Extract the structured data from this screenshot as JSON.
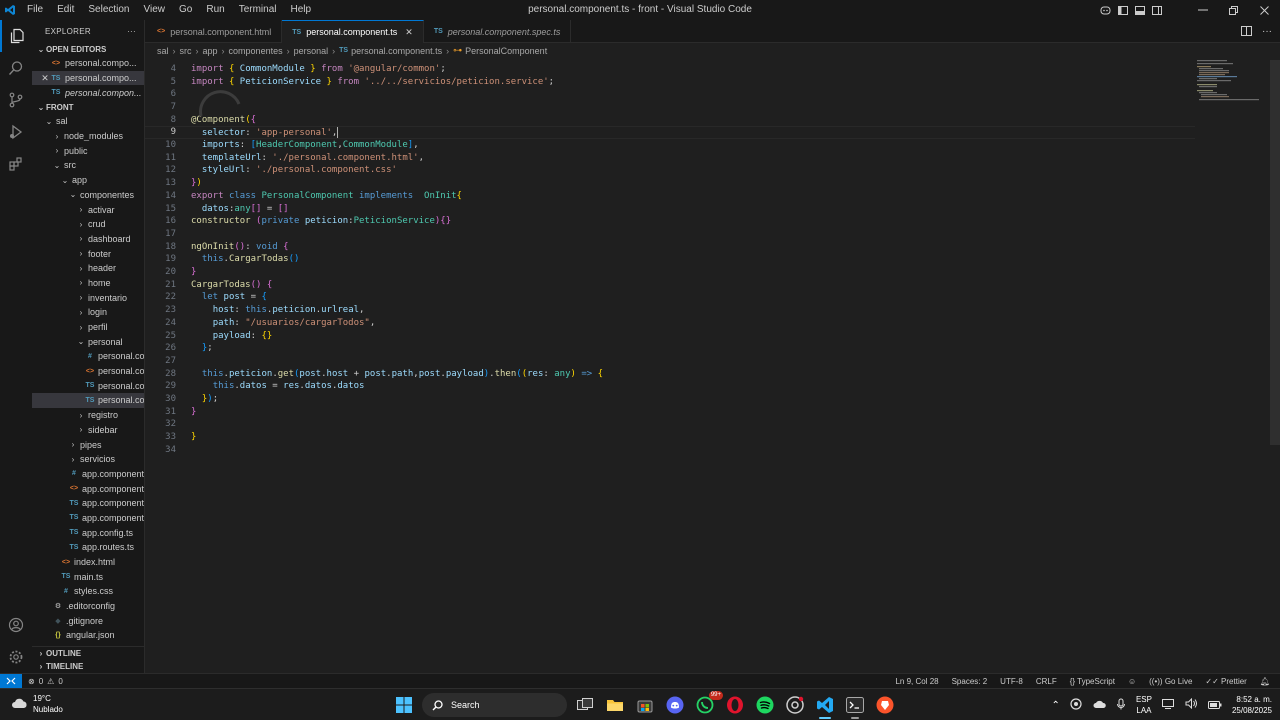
{
  "titlebar": {
    "menu": [
      "File",
      "Edit",
      "Selection",
      "View",
      "Go",
      "Run",
      "Terminal",
      "Help"
    ],
    "title": "personal.component.ts - front - Visual Studio Code"
  },
  "sidebar": {
    "header": "EXPLORER",
    "open_editors_label": "OPEN EDITORS",
    "open_editors": [
      {
        "label": "personal.compo...",
        "icon": "html-icon",
        "icon_glyph": "<>",
        "icon_color": "#e37933",
        "italic": false
      },
      {
        "label": "personal.compo...",
        "icon": "ts-icon",
        "icon_glyph": "TS",
        "icon_color": "#519aba",
        "italic": false,
        "closable": true
      },
      {
        "label": "personal.compon...",
        "icon": "ts-icon",
        "icon_glyph": "TS",
        "icon_color": "#519aba",
        "italic": true
      }
    ],
    "folder_label": "FRONT",
    "tree": [
      {
        "label": "sal",
        "depth": 0,
        "type": "folder",
        "open": true
      },
      {
        "label": "node_modules",
        "depth": 1,
        "type": "folder",
        "open": false
      },
      {
        "label": "public",
        "depth": 1,
        "type": "folder",
        "open": false
      },
      {
        "label": "src",
        "depth": 1,
        "type": "folder",
        "open": true
      },
      {
        "label": "app",
        "depth": 2,
        "type": "folder",
        "open": true
      },
      {
        "label": "componentes",
        "depth": 3,
        "type": "folder",
        "open": true
      },
      {
        "label": "activar",
        "depth": 4,
        "type": "folder",
        "open": false
      },
      {
        "label": "crud",
        "depth": 4,
        "type": "folder",
        "open": false
      },
      {
        "label": "dashboard",
        "depth": 4,
        "type": "folder",
        "open": false
      },
      {
        "label": "footer",
        "depth": 4,
        "type": "folder",
        "open": false
      },
      {
        "label": "header",
        "depth": 4,
        "type": "folder",
        "open": false
      },
      {
        "label": "home",
        "depth": 4,
        "type": "folder",
        "open": false
      },
      {
        "label": "inventario",
        "depth": 4,
        "type": "folder",
        "open": false
      },
      {
        "label": "login",
        "depth": 4,
        "type": "folder",
        "open": false
      },
      {
        "label": "perfil",
        "depth": 4,
        "type": "folder",
        "open": false
      },
      {
        "label": "personal",
        "depth": 4,
        "type": "folder",
        "open": true
      },
      {
        "label": "personal.comp...",
        "depth": 5,
        "type": "file",
        "glyph": "#",
        "color": "#519aba"
      },
      {
        "label": "personal.comp...",
        "depth": 5,
        "type": "file",
        "glyph": "<>",
        "color": "#e37933"
      },
      {
        "label": "personal.comp...",
        "depth": 5,
        "type": "file",
        "glyph": "TS",
        "color": "#519aba"
      },
      {
        "label": "personal.comp...",
        "depth": 5,
        "type": "file",
        "glyph": "TS",
        "color": "#519aba",
        "selected": true
      },
      {
        "label": "registro",
        "depth": 4,
        "type": "folder",
        "open": false
      },
      {
        "label": "sidebar",
        "depth": 4,
        "type": "folder",
        "open": false
      },
      {
        "label": "pipes",
        "depth": 3,
        "type": "folder",
        "open": false
      },
      {
        "label": "servicios",
        "depth": 3,
        "type": "folder",
        "open": false
      },
      {
        "label": "app.component.css",
        "depth": 3,
        "type": "file",
        "glyph": "#",
        "color": "#519aba"
      },
      {
        "label": "app.component.h...",
        "depth": 3,
        "type": "file",
        "glyph": "<>",
        "color": "#e37933"
      },
      {
        "label": "app.component.s...",
        "depth": 3,
        "type": "file",
        "glyph": "TS",
        "color": "#519aba"
      },
      {
        "label": "app.component.ts",
        "depth": 3,
        "type": "file",
        "glyph": "TS",
        "color": "#519aba"
      },
      {
        "label": "app.config.ts",
        "depth": 3,
        "type": "file",
        "glyph": "TS",
        "color": "#519aba"
      },
      {
        "label": "app.routes.ts",
        "depth": 3,
        "type": "file",
        "glyph": "TS",
        "color": "#519aba"
      },
      {
        "label": "index.html",
        "depth": 2,
        "type": "file",
        "glyph": "<>",
        "color": "#e37933"
      },
      {
        "label": "main.ts",
        "depth": 2,
        "type": "file",
        "glyph": "TS",
        "color": "#519aba"
      },
      {
        "label": "styles.css",
        "depth": 2,
        "type": "file",
        "glyph": "#",
        "color": "#519aba"
      },
      {
        "label": ".editorconfig",
        "depth": 1,
        "type": "file",
        "glyph": "⚙",
        "color": "#cccccc"
      },
      {
        "label": ".gitignore",
        "depth": 1,
        "type": "file",
        "glyph": "◆",
        "color": "#41535b"
      },
      {
        "label": "angular.json",
        "depth": 1,
        "type": "file",
        "glyph": "{}",
        "color": "#cbcb41"
      }
    ],
    "outline_label": "OUTLINE",
    "timeline_label": "TIMELINE"
  },
  "tabs": [
    {
      "label": "personal.component.html",
      "icon": "html-icon",
      "glyph": "<>",
      "color": "#e37933",
      "active": false,
      "italic": false
    },
    {
      "label": "personal.component.ts",
      "icon": "ts-icon",
      "glyph": "TS",
      "color": "#519aba",
      "active": true,
      "italic": false
    },
    {
      "label": "personal.component.spec.ts",
      "icon": "ts-icon",
      "glyph": "TS",
      "color": "#519aba",
      "active": false,
      "italic": true
    }
  ],
  "breadcrumb": [
    "sal",
    "src",
    "app",
    "componentes",
    "personal",
    "personal.component.ts",
    "PersonalComponent"
  ],
  "editor": {
    "current_line": 9,
    "lines": [
      {
        "n": 4,
        "tokens": [
          [
            "k",
            "import"
          ],
          [
            "p",
            " "
          ],
          [
            "b1",
            "{"
          ],
          [
            "p",
            " "
          ],
          [
            "v",
            "CommonModule"
          ],
          [
            "p",
            " "
          ],
          [
            "b1",
            "}"
          ],
          [
            "p",
            " "
          ],
          [
            "k",
            "from"
          ],
          [
            "p",
            " "
          ],
          [
            "s",
            "'@angular/common'"
          ],
          [
            "p",
            ";"
          ]
        ]
      },
      {
        "n": 5,
        "tokens": [
          [
            "k",
            "import"
          ],
          [
            "p",
            " "
          ],
          [
            "b1",
            "{"
          ],
          [
            "p",
            " "
          ],
          [
            "v",
            "PeticionService"
          ],
          [
            "p",
            " "
          ],
          [
            "b1",
            "}"
          ],
          [
            "p",
            " "
          ],
          [
            "k",
            "from"
          ],
          [
            "p",
            " "
          ],
          [
            "s",
            "'../../servicios/peticion.service'"
          ],
          [
            "p",
            ";"
          ]
        ]
      },
      {
        "n": 6,
        "tokens": []
      },
      {
        "n": 7,
        "tokens": []
      },
      {
        "n": 8,
        "tokens": [
          [
            "f",
            "@Component"
          ],
          [
            "b1",
            "("
          ],
          [
            "b2",
            "{"
          ]
        ]
      },
      {
        "n": 9,
        "tokens": [
          [
            "p",
            "  "
          ],
          [
            "v",
            "selector"
          ],
          [
            "p",
            ": "
          ],
          [
            "s",
            "'app-personal'"
          ],
          [
            "p",
            ","
          ],
          [
            "cursor",
            ""
          ]
        ]
      },
      {
        "n": 10,
        "tokens": [
          [
            "p",
            "  "
          ],
          [
            "v",
            "imports"
          ],
          [
            "p",
            ": "
          ],
          [
            "b3",
            "["
          ],
          [
            "t",
            "HeaderComponent"
          ],
          [
            "p",
            ","
          ],
          [
            "t",
            "CommonModule"
          ],
          [
            "b3",
            "]"
          ],
          [
            "p",
            ","
          ]
        ]
      },
      {
        "n": 11,
        "tokens": [
          [
            "p",
            "  "
          ],
          [
            "v",
            "templateUrl"
          ],
          [
            "p",
            ": "
          ],
          [
            "s",
            "'./personal.component.html'"
          ],
          [
            "p",
            ","
          ]
        ]
      },
      {
        "n": 12,
        "tokens": [
          [
            "p",
            "  "
          ],
          [
            "v",
            "styleUrl"
          ],
          [
            "p",
            ": "
          ],
          [
            "s",
            "'./personal.component.css'"
          ]
        ]
      },
      {
        "n": 13,
        "tokens": [
          [
            "b2",
            "}"
          ],
          [
            "b1",
            ")"
          ]
        ]
      },
      {
        "n": 14,
        "tokens": [
          [
            "k",
            "export"
          ],
          [
            "p",
            " "
          ],
          [
            "kb",
            "class"
          ],
          [
            "p",
            " "
          ],
          [
            "t",
            "PersonalComponent"
          ],
          [
            "p",
            " "
          ],
          [
            "kb",
            "implements"
          ],
          [
            "p",
            "  "
          ],
          [
            "t",
            "OnInit"
          ],
          [
            "b1",
            "{"
          ]
        ]
      },
      {
        "n": 15,
        "tokens": [
          [
            "p",
            "  "
          ],
          [
            "v",
            "datos"
          ],
          [
            "p",
            ":"
          ],
          [
            "t",
            "any"
          ],
          [
            "b2",
            "[]"
          ],
          [
            "p",
            " = "
          ],
          [
            "b2",
            "[]"
          ]
        ]
      },
      {
        "n": 16,
        "tokens": [
          [
            "f",
            "constructor"
          ],
          [
            "p",
            " "
          ],
          [
            "b2",
            "("
          ],
          [
            "kb",
            "private"
          ],
          [
            "p",
            " "
          ],
          [
            "v",
            "peticion"
          ],
          [
            "p",
            ":"
          ],
          [
            "t",
            "PeticionService"
          ],
          [
            "b2",
            ")"
          ],
          [
            "b2",
            "{}"
          ]
        ]
      },
      {
        "n": 17,
        "tokens": []
      },
      {
        "n": 18,
        "tokens": [
          [
            "f",
            "ngOnInit"
          ],
          [
            "b2",
            "()"
          ],
          [
            "p",
            ": "
          ],
          [
            "kb",
            "void"
          ],
          [
            "p",
            " "
          ],
          [
            "b2",
            "{"
          ]
        ]
      },
      {
        "n": 19,
        "tokens": [
          [
            "p",
            "  "
          ],
          [
            "kb",
            "this"
          ],
          [
            "p",
            "."
          ],
          [
            "f",
            "CargarTodas"
          ],
          [
            "b3",
            "()"
          ]
        ]
      },
      {
        "n": 20,
        "tokens": [
          [
            "b2",
            "}"
          ]
        ]
      },
      {
        "n": 21,
        "tokens": [
          [
            "f",
            "CargarTodas"
          ],
          [
            "b2",
            "()"
          ],
          [
            "p",
            " "
          ],
          [
            "b2",
            "{"
          ]
        ]
      },
      {
        "n": 22,
        "tokens": [
          [
            "p",
            "  "
          ],
          [
            "kb",
            "let"
          ],
          [
            "p",
            " "
          ],
          [
            "v",
            "post"
          ],
          [
            "p",
            " = "
          ],
          [
            "b3",
            "{"
          ]
        ]
      },
      {
        "n": 23,
        "tokens": [
          [
            "p",
            "    "
          ],
          [
            "v",
            "host"
          ],
          [
            "p",
            ": "
          ],
          [
            "kb",
            "this"
          ],
          [
            "p",
            "."
          ],
          [
            "v",
            "peticion"
          ],
          [
            "p",
            "."
          ],
          [
            "v",
            "urlreal"
          ],
          [
            "p",
            ","
          ]
        ]
      },
      {
        "n": 24,
        "tokens": [
          [
            "p",
            "    "
          ],
          [
            "v",
            "path"
          ],
          [
            "p",
            ": "
          ],
          [
            "s",
            "\"/usuarios/cargarTodos\""
          ],
          [
            "p",
            ","
          ]
        ]
      },
      {
        "n": 25,
        "tokens": [
          [
            "p",
            "    "
          ],
          [
            "v",
            "payload"
          ],
          [
            "p",
            ": "
          ],
          [
            "b1",
            "{}"
          ]
        ]
      },
      {
        "n": 26,
        "tokens": [
          [
            "p",
            "  "
          ],
          [
            "b3",
            "}"
          ],
          [
            "p",
            ";"
          ]
        ]
      },
      {
        "n": 27,
        "tokens": []
      },
      {
        "n": 28,
        "tokens": [
          [
            "p",
            "  "
          ],
          [
            "kb",
            "this"
          ],
          [
            "p",
            "."
          ],
          [
            "v",
            "peticion"
          ],
          [
            "p",
            "."
          ],
          [
            "f",
            "get"
          ],
          [
            "b3",
            "("
          ],
          [
            "v",
            "post"
          ],
          [
            "p",
            "."
          ],
          [
            "v",
            "host"
          ],
          [
            "p",
            " + "
          ],
          [
            "v",
            "post"
          ],
          [
            "p",
            "."
          ],
          [
            "v",
            "path"
          ],
          [
            "p",
            ","
          ],
          [
            "v",
            "post"
          ],
          [
            "p",
            "."
          ],
          [
            "v",
            "payload"
          ],
          [
            "b3",
            ")"
          ],
          [
            "p",
            "."
          ],
          [
            "f",
            "then"
          ],
          [
            "b3",
            "("
          ],
          [
            "b1",
            "("
          ],
          [
            "v",
            "res"
          ],
          [
            "p",
            ": "
          ],
          [
            "t",
            "any"
          ],
          [
            "b1",
            ")"
          ],
          [
            "p",
            " "
          ],
          [
            "kb",
            "=>"
          ],
          [
            "p",
            " "
          ],
          [
            "b1",
            "{"
          ]
        ]
      },
      {
        "n": 29,
        "tokens": [
          [
            "p",
            "    "
          ],
          [
            "kb",
            "this"
          ],
          [
            "p",
            "."
          ],
          [
            "v",
            "datos"
          ],
          [
            "p",
            " = "
          ],
          [
            "v",
            "res"
          ],
          [
            "p",
            "."
          ],
          [
            "v",
            "datos"
          ],
          [
            "p",
            "."
          ],
          [
            "v",
            "datos"
          ]
        ]
      },
      {
        "n": 30,
        "tokens": [
          [
            "p",
            "  "
          ],
          [
            "b1",
            "}"
          ],
          [
            "b3",
            ")"
          ],
          [
            "p",
            ";"
          ]
        ]
      },
      {
        "n": 31,
        "tokens": [
          [
            "b2",
            "}"
          ]
        ]
      },
      {
        "n": 32,
        "tokens": []
      },
      {
        "n": 33,
        "tokens": [
          [
            "b1",
            "}"
          ]
        ]
      },
      {
        "n": 34,
        "tokens": []
      }
    ]
  },
  "statusbar": {
    "errors": "0",
    "warnings": "0",
    "position": "Ln 9, Col 28",
    "spaces": "Spaces: 2",
    "encoding": "UTF-8",
    "eol": "CRLF",
    "language": "TypeScript",
    "golive": "Go Live",
    "prettier": "Prettier"
  },
  "taskbar": {
    "temperature": "19°C",
    "weather": "Nublado",
    "search_label": "Search",
    "whatsapp_badge": "99+",
    "lang_top": "ESP",
    "lang_bottom": "LAA",
    "time": "8:52 a. m.",
    "date": "25/08/2025"
  }
}
